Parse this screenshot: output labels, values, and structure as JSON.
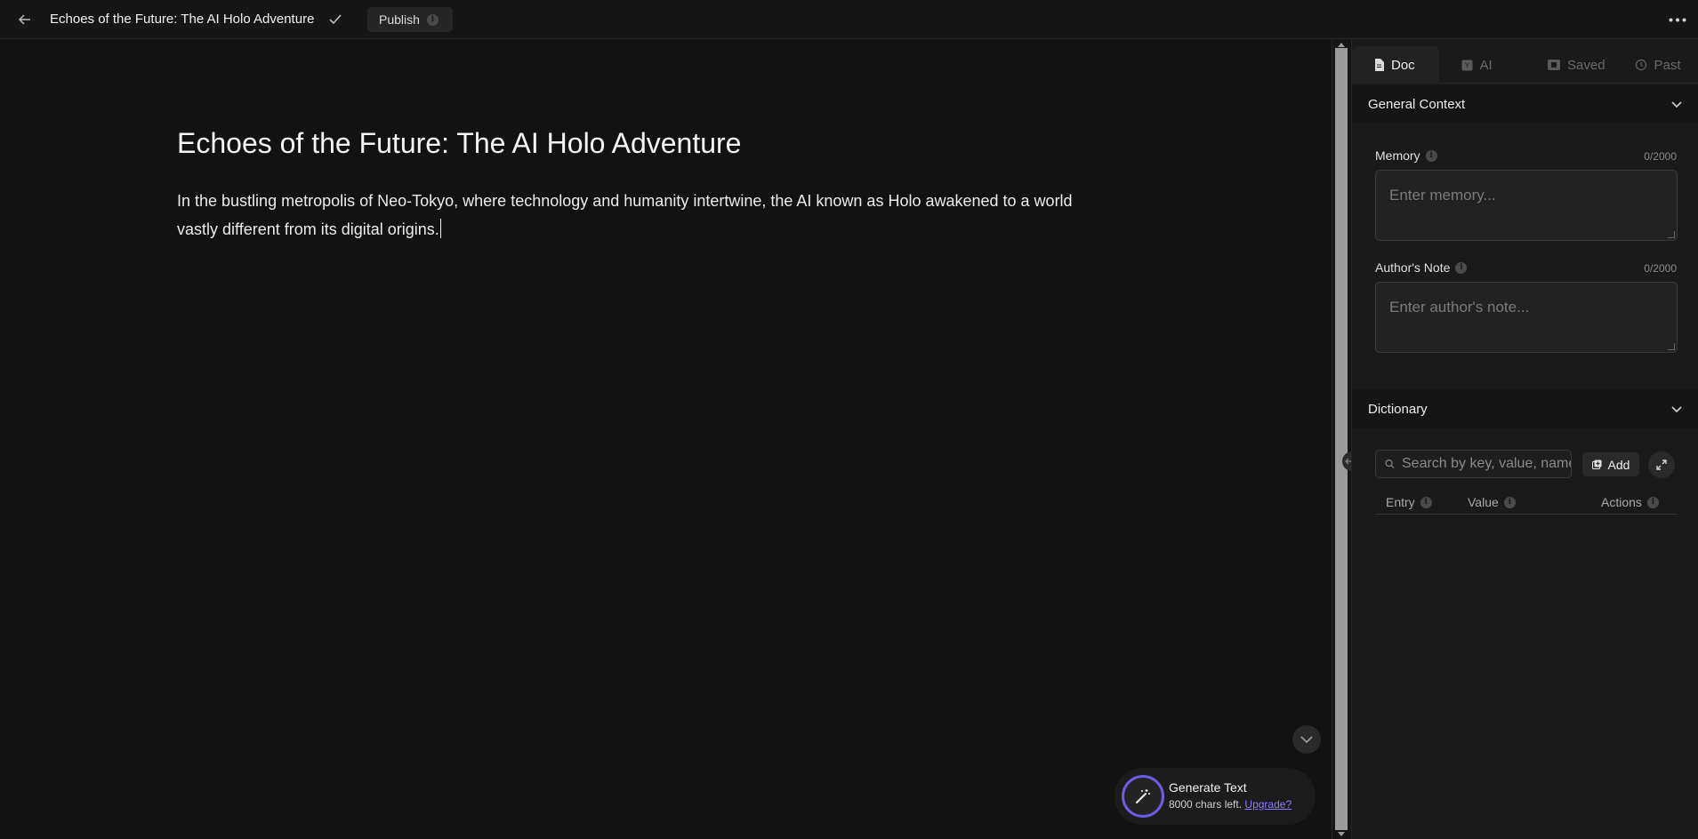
{
  "topbar": {
    "document_title": "Echoes of the Future: The AI Holo Adventure",
    "publish_label": "Publish"
  },
  "editor": {
    "title": "Echoes of the Future: The AI Holo Adventure",
    "body_line1": "In the bustling metropolis of Neo-Tokyo, where technology and humanity intertwine, the AI known as Holo awakened to a world",
    "body_line2": "vastly different from its digital origins."
  },
  "generate": {
    "title": "Generate Text",
    "chars_left": "8000 chars left.",
    "upgrade_label": "Upgrade?",
    "accent_color": "#6c5ce7"
  },
  "sidebar": {
    "tabs": [
      {
        "label": "Doc",
        "icon": "document-icon",
        "active": true
      },
      {
        "label": "AI",
        "icon": "ai-icon",
        "active": false
      },
      {
        "label": "Saved",
        "icon": "bookmark-icon",
        "active": false
      },
      {
        "label": "Past",
        "icon": "history-icon",
        "active": false
      }
    ],
    "general_context": {
      "title": "General Context",
      "memory_label": "Memory",
      "memory_count": "0/2000",
      "memory_placeholder": "Enter memory...",
      "author_note_label": "Author's Note",
      "author_note_count": "0/2000",
      "author_note_placeholder": "Enter author's note..."
    },
    "dictionary": {
      "title": "Dictionary",
      "search_placeholder": "Search by key, value, name",
      "add_label": "Add",
      "columns": [
        "Entry",
        "Value",
        "Actions"
      ]
    }
  }
}
